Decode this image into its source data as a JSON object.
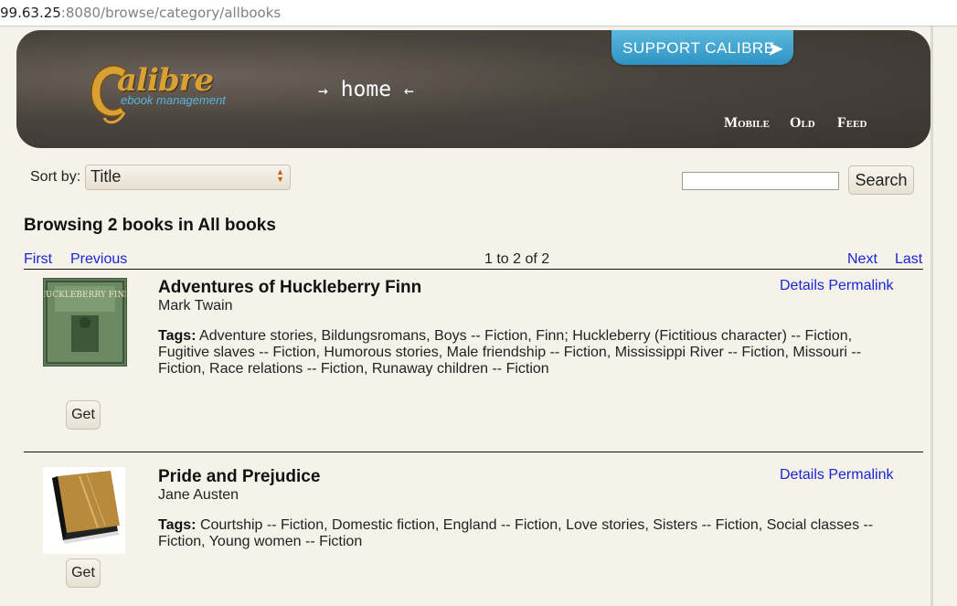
{
  "browser": {
    "url_host": "99.63.25",
    "url_rest": ":8080/browse/category/allbooks"
  },
  "header": {
    "support_label": "SUPPORT CALIBRE",
    "logo_title": "alibre",
    "logo_subtitle": "ebook management",
    "home_label": "home",
    "nav": [
      "Mobile",
      "Old",
      "Feed"
    ]
  },
  "controls": {
    "sort_label": "Sort by:",
    "sort_value": "Title",
    "search_button": "Search",
    "search_value": ""
  },
  "browse_heading": "Browsing 2 books in All books",
  "pager": {
    "first": "First",
    "previous": "Previous",
    "count": "1 to 2 of 2",
    "next": "Next",
    "last": "Last"
  },
  "books": [
    {
      "title": "Adventures of Huckleberry Finn",
      "author": "Mark Twain",
      "tags_label": "Tags:",
      "tags_line1": "Adventure stories, Bildungsromans, Boys -- Fiction, Finn; Huckleberry (Fictitious character) -- Fiction,",
      "tags_line2": "Fugitive slaves -- Fiction, Humorous stories, Male friendship -- Fiction, Mississippi River -- Fiction, Missouri --",
      "tags_line3": "Fiction, Race relations -- Fiction, Runaway children -- Fiction",
      "details": "Details",
      "permalink": "Permalink",
      "get": "Get",
      "cover_text": "HUCKLEBERRY FINN"
    },
    {
      "title": "Pride and Prejudice",
      "author": "Jane Austen",
      "tags_label": "Tags:",
      "tags_line1": "Courtship -- Fiction, Domestic fiction, England -- Fiction, Love stories, Sisters -- Fiction, Social classes --",
      "tags_line2": "Fiction, Young women -- Fiction",
      "tags_line3": "",
      "details": "Details",
      "permalink": "Permalink",
      "get": "Get"
    }
  ],
  "colors": {
    "link": "#1a25d6",
    "header_bg": "#4a433d",
    "support_bg": "#2e93c3",
    "page_bg": "#f5f2e9"
  }
}
